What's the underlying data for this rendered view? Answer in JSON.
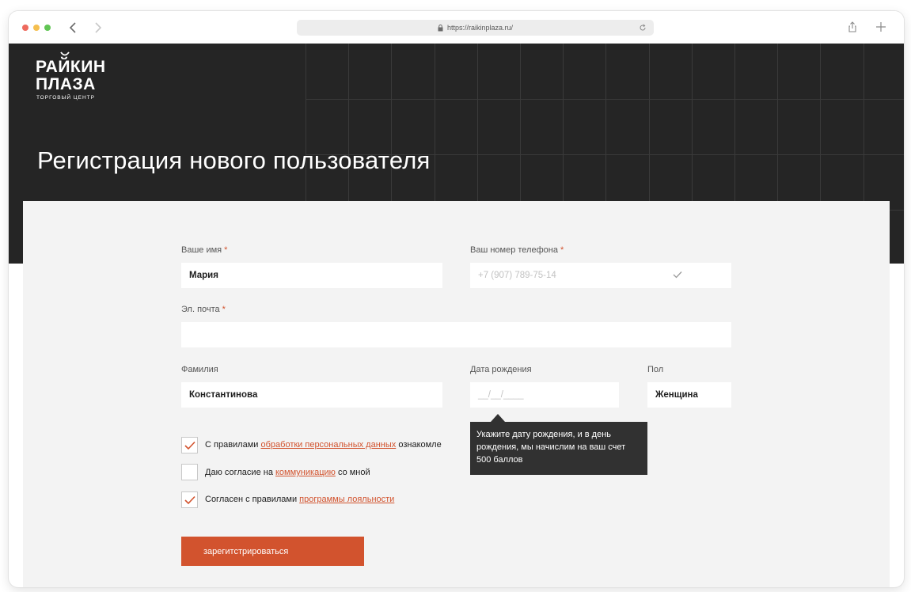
{
  "browser": {
    "url": "https://raikinplaza.ru/"
  },
  "logo": {
    "line1": "РАЙКИН",
    "line2": "ПЛАЗА",
    "subtitle": "ТОРГОВЫЙ ЦЕНТР"
  },
  "page": {
    "title": "Регистрация нового пользователя"
  },
  "form": {
    "name": {
      "label": "Ваше имя",
      "required_mark": "*",
      "value": "Мария"
    },
    "phone": {
      "label": "Ваш номер телефона",
      "required_mark": "*",
      "value": "+7 (907) 789-75-14"
    },
    "email": {
      "label": "Эл. почта",
      "required_mark": "*",
      "value": ""
    },
    "surname": {
      "label": "Фамилия",
      "value": "Константинова"
    },
    "birthdate": {
      "label": "Дата рождения",
      "placeholder": "__/__/____"
    },
    "gender": {
      "label": "Пол",
      "value": "Женщина"
    },
    "tooltip": "Укажите дату рождения, и в день рождения, мы начислим на ваш счет 500 баллов",
    "consents": [
      {
        "checked": true,
        "prefix": "С правилами ",
        "link": "обработки персональных данных",
        "suffix": " ознакомле"
      },
      {
        "checked": false,
        "prefix": "Даю согласие на ",
        "link": "коммуникацию",
        "suffix": " со мной"
      },
      {
        "checked": true,
        "prefix": "Согласен с правилами ",
        "link": "программы лояльности",
        "suffix": ""
      }
    ],
    "submit_label": "зарегитстрироваться"
  },
  "colors": {
    "accent": "#d2532e",
    "hero_bg": "#252525",
    "card_bg": "#f3f3f3"
  }
}
